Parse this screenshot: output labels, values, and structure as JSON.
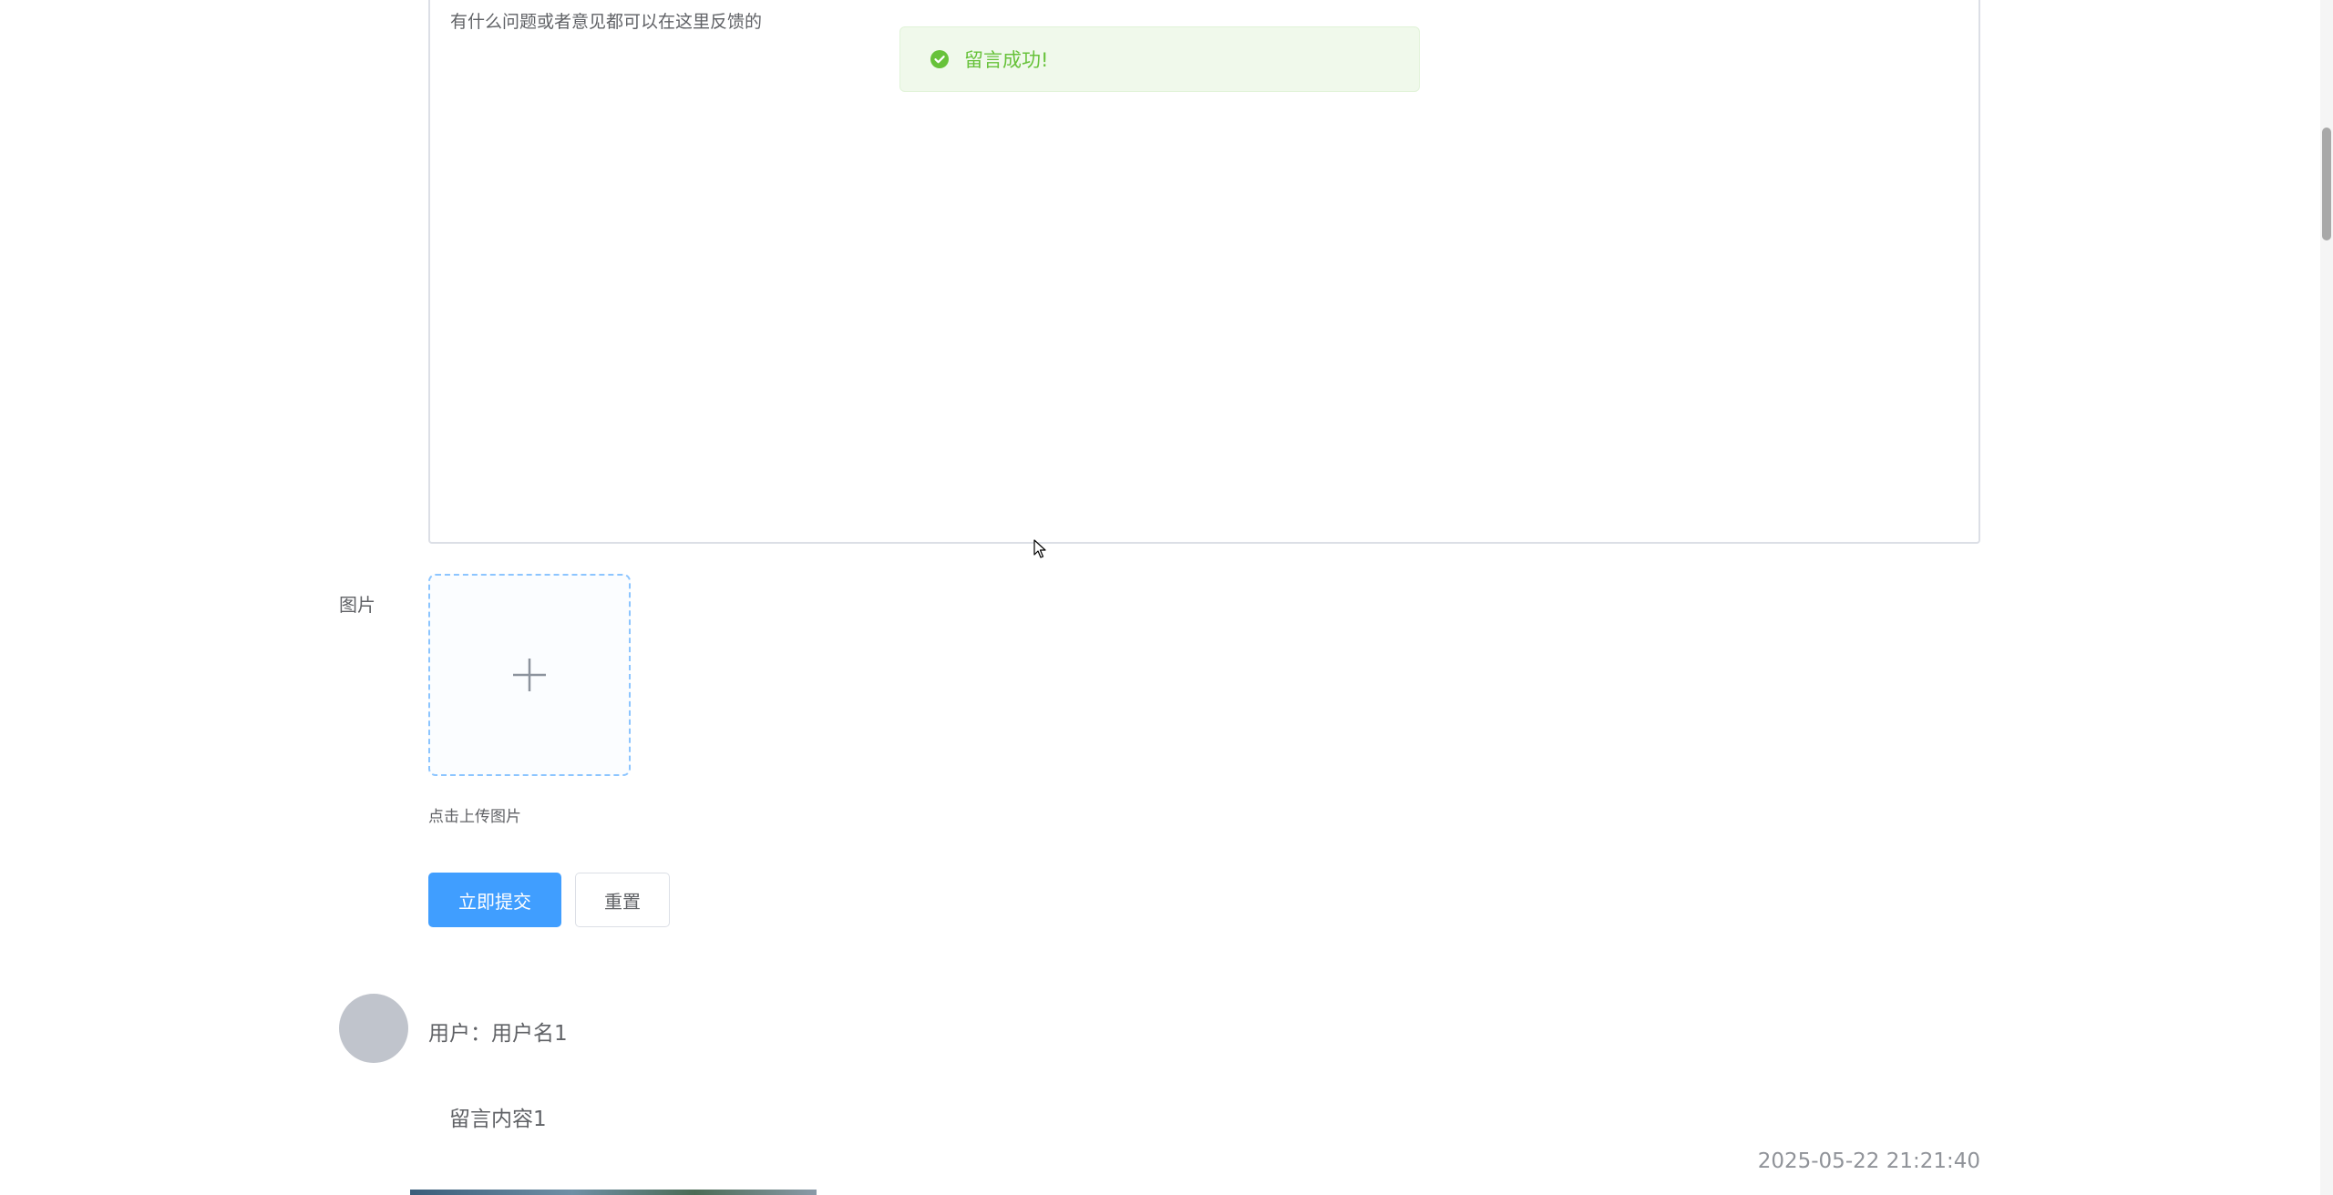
{
  "feedback_form": {
    "content_placeholder": "有什么问题或者意见都可以在这里反馈的",
    "image_label": "图片",
    "upload_hint": "点击上传图片",
    "submit_label": "立即提交",
    "reset_label": "重置"
  },
  "toast": {
    "message": "留言成功!",
    "type": "success",
    "icon": "check-circle-icon"
  },
  "comments": [
    {
      "user": "用户：用户名1",
      "content": "留言内容1",
      "time": "2025-05-22 21:21:40"
    }
  ],
  "colors": {
    "primary": "#409eff",
    "success": "#67c23a",
    "success_bg": "#f0f9eb",
    "text": "#606266",
    "muted": "#909399",
    "border": "#dcdfe6"
  }
}
